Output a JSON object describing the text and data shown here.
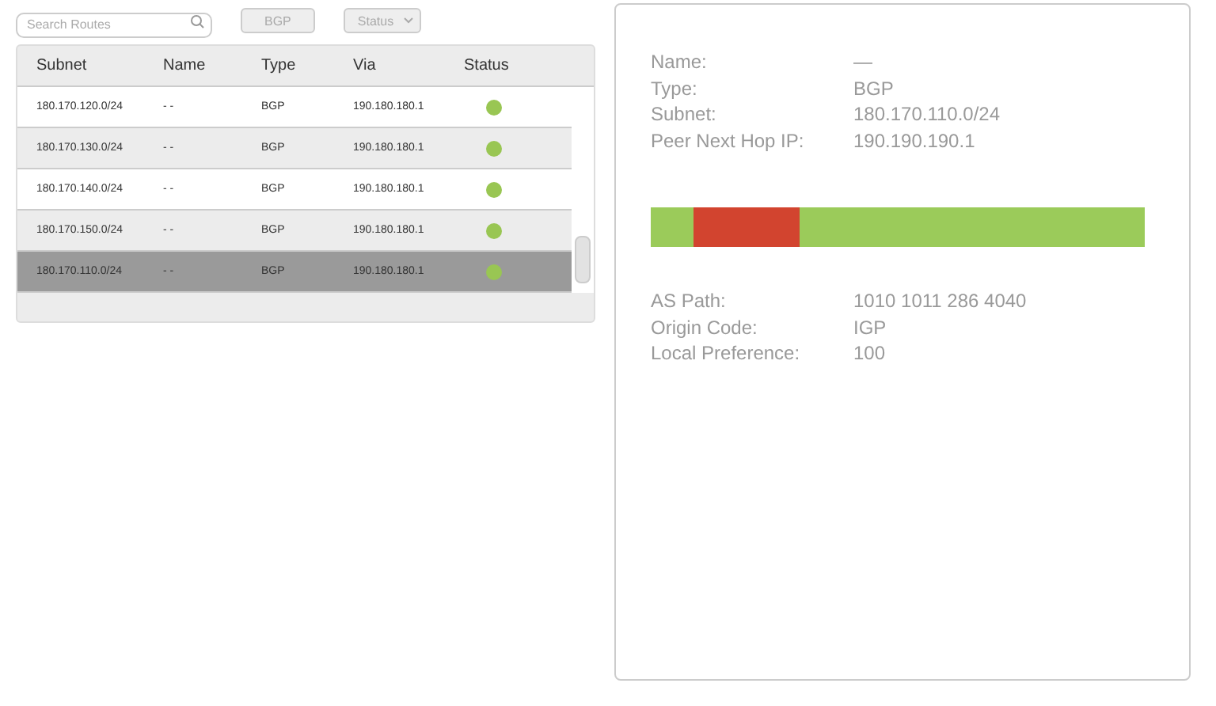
{
  "toolbar": {
    "search": {
      "placeholder": "Search Routes"
    },
    "type_filter": "BGP",
    "status_filter": "Status"
  },
  "table": {
    "columns": [
      "Subnet",
      "Name",
      "Type",
      "Via",
      "Status"
    ],
    "rows": [
      {
        "subnet": "180.170.120.0/24",
        "name": "- -",
        "type": "BGP",
        "via": "190.180.180.1",
        "color": "#99c653",
        "selected": false
      },
      {
        "subnet": "180.170.130.0/24",
        "name": "- -",
        "type": "BGP",
        "via": "190.180.180.1",
        "color": "#99c653",
        "selected": false
      },
      {
        "subnet": "180.170.140.0/24",
        "name": "- -",
        "type": "BGP",
        "via": "190.180.180.1",
        "color": "#99c653",
        "selected": false
      },
      {
        "subnet": "180.170.150.0/24",
        "name": "- -",
        "type": "BGP",
        "via": "190.180.180.1",
        "color": "#99c653",
        "selected": false
      },
      {
        "subnet": "180.170.110.0/24",
        "name": "- -",
        "type": "BGP",
        "via": "190.180.180.1",
        "color": "#99c653",
        "selected": true
      }
    ]
  },
  "details": {
    "fields": [
      {
        "label": "Name:",
        "value": "—"
      },
      {
        "label": "Type:",
        "value": "BGP"
      },
      {
        "label": "Subnet:",
        "value": "180.170.110.0/24"
      },
      {
        "label": "Peer Next Hop IP:",
        "value": "190.190.190.1"
      }
    ],
    "timeline": [
      {
        "color": "#9bcb5a"
      },
      {
        "color": "#d2442f"
      },
      {
        "color": "#9bcb5a"
      }
    ],
    "attributes": [
      {
        "label": "AS Path:",
        "value": "1010 1011 286 4040"
      },
      {
        "label": "Origin Code:",
        "value": "IGP"
      },
      {
        "label": "Local Preference:",
        "value": "100"
      }
    ]
  }
}
